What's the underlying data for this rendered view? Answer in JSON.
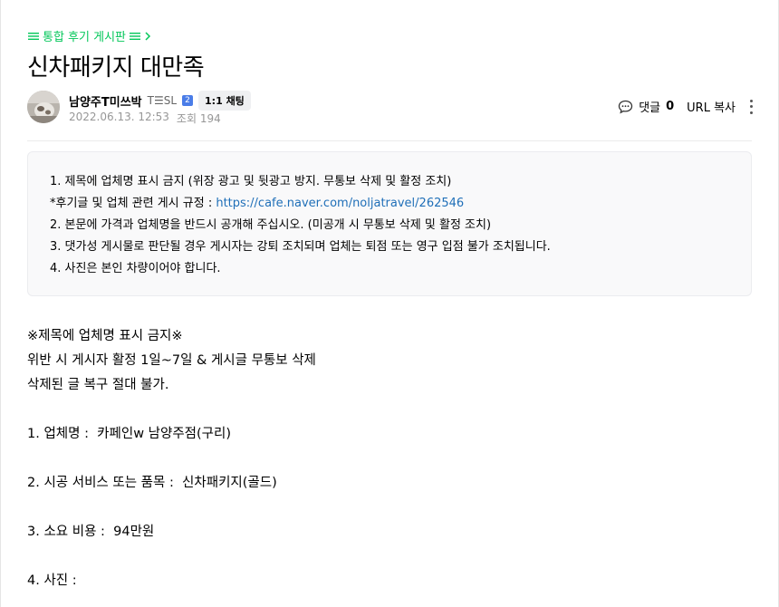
{
  "board_link": {
    "label": "통합 후기 게시판"
  },
  "post": {
    "title": "신차패키지 대만족",
    "author": "남양주T미쓰박",
    "grade": "T☰SL",
    "grade_badge": "2",
    "chat_label": "1:1 채팅",
    "date": "2022.06.13. 12:53",
    "views": "조회 194"
  },
  "tools": {
    "comment_label": "댓글",
    "comment_count": "0",
    "url_copy_label": "URL 복사"
  },
  "notice": {
    "line1": "1. 제목에 업체명 표시 금지 (위장 광고 및 뒷광고 방지. 무통보 삭제 및 활정 조치)",
    "line2_prefix": "*후기글 및 업체 관련 게시 규정 : ",
    "line2_link": "https://cafe.naver.com/noljatravel/262546",
    "line3": "2. 본문에 가격과 업체명을 반드시 공개해 주십시오. (미공개 시 무통보 삭제 및 활정 조치)",
    "line4": "3. 댓가성 게시물로 판단될 경우 게시자는 강퇴 조치되며 업체는 퇴점 또는 영구 입점 불가 조치됩니다.",
    "line5": "4. 사진은 본인 차량이어야 합니다."
  },
  "body": {
    "l1": "※제목에 업체명 표시 금지※",
    "l2": "위반 시 게시자 활정 1일~7일 & 게시글 무통보 삭제",
    "l3": "삭제된 글 복구 절대 불가.",
    "l4": "1. 업체명 :  카페인w 남양주점(구리)",
    "l5": "2. 시공 서비스 또는 품목 :  신차패키지(골드)",
    "l6": "3. 소요 비용 :  94만원",
    "l7": "4. 사진 :"
  },
  "colors": {
    "accent": "#03c75a",
    "link": "#1f6fb8",
    "notice_bg": "#f9f9fa"
  },
  "icons": [
    "menu-icon",
    "chevron-right-icon",
    "comment-icon",
    "more-vertical-icon"
  ]
}
